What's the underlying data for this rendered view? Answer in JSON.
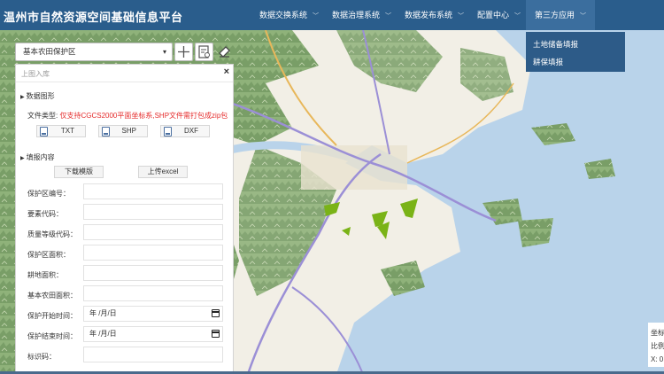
{
  "header": {
    "title": "温州市自然资源空间基础信息平台",
    "nav": [
      {
        "label": "数据交换系统"
      },
      {
        "label": "数据治理系统"
      },
      {
        "label": "数据发布系统"
      },
      {
        "label": "配置中心"
      },
      {
        "label": "第三方应用"
      }
    ],
    "dropdown": [
      "土地储备填报",
      "耕保填报"
    ]
  },
  "toolbar": {
    "layer_select": "基本农田保护区"
  },
  "panel": {
    "title": "上图入库",
    "close": "×",
    "section_graphics": "数据图形",
    "file_type_label": "文件类型:",
    "file_type_note": "仅支持CGCS2000平面坐标系,SHP文件需打包成zip包",
    "file_buttons": [
      "TXT",
      "SHP",
      "DXF"
    ],
    "section_fill": "填报内容",
    "download_template": "下载模版",
    "upload_excel": "上传excel",
    "fields": [
      {
        "label": "保护区编号：",
        "value": ""
      },
      {
        "label": "要素代码：",
        "value": ""
      },
      {
        "label": "质量等级代码：",
        "value": ""
      },
      {
        "label": "保护区面积：",
        "value": ""
      },
      {
        "label": "耕地面积：",
        "value": ""
      },
      {
        "label": "基本农田面积：",
        "value": ""
      },
      {
        "label": "保护开始时间：",
        "value": "年 /月/日"
      },
      {
        "label": "保护结束时间：",
        "value": "年 /月/日"
      },
      {
        "label": "标识码：",
        "value": ""
      }
    ]
  },
  "status": {
    "lines": [
      "坐标",
      "比例",
      "X: 0"
    ]
  },
  "colors": {
    "topbar": "#2a5d8c",
    "dropdown": "#2d5b88",
    "warning_text": "#e52b2b",
    "land": "#f2efe6",
    "forest": "#7fa46a",
    "sea": "#b9d3ea"
  }
}
